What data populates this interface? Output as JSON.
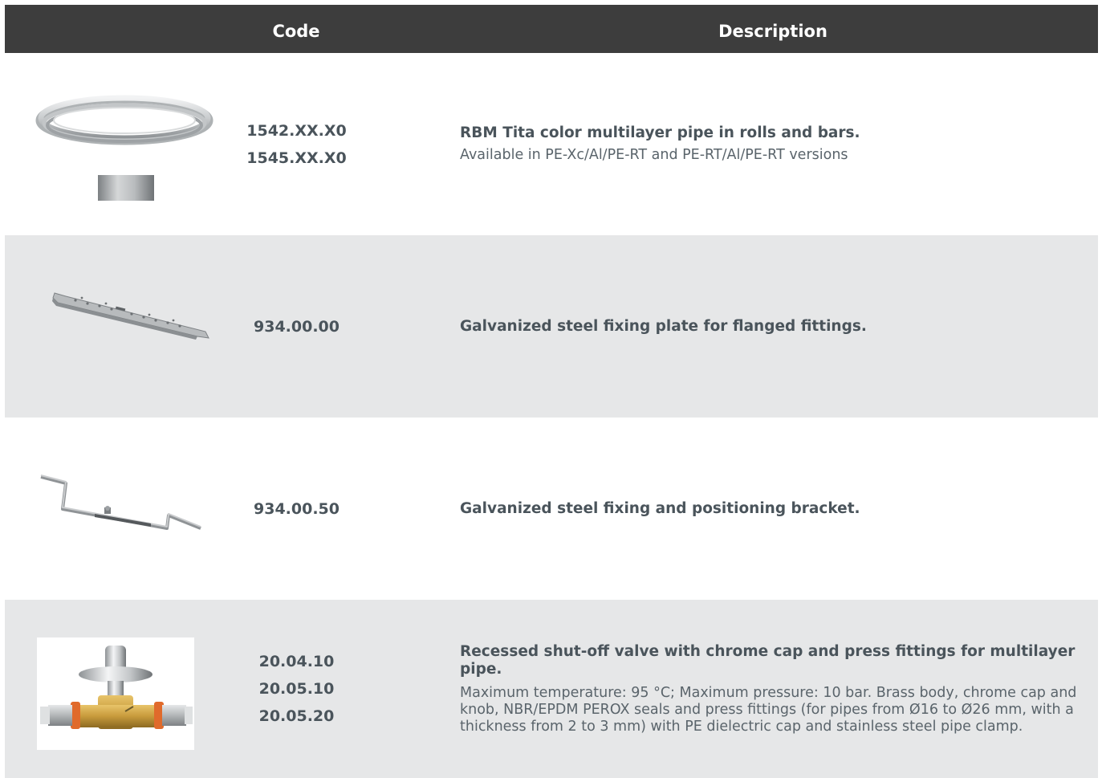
{
  "header": {
    "code_label": "Code",
    "description_label": "Description",
    "background_color": "#3d3d3d"
  },
  "rows": [
    {
      "image": "multilayer-pipe-coil-icon",
      "codes": [
        "1542.XX.X0",
        "1545.XX.X0"
      ],
      "title": "RBM Tita color multilayer pipe in rolls and bars.",
      "body": "Available in PE-Xc/Al/PE-RT and PE-RT/Al/PE-RT versions",
      "shaded": false
    },
    {
      "image": "fixing-plate-icon",
      "codes": [
        "934.00.00"
      ],
      "title": "Galvanized steel fixing plate for flanged fittings.",
      "body": "",
      "shaded": true
    },
    {
      "image": "positioning-bracket-icon",
      "codes": [
        "934.00.50"
      ],
      "title": "Galvanized steel fixing and positioning bracket.",
      "body": "",
      "shaded": false
    },
    {
      "image": "shut-off-valve-icon",
      "codes": [
        "20.04.10",
        "20.05.10",
        "20.05.20"
      ],
      "title": "Recessed shut-off valve with chrome cap and press fittings for multilayer pipe.",
      "body": "Maximum temperature: 95 °C; Maximum pressure: 10 bar. Brass body, chrome cap and knob, NBR/EPDM PEROX seals and press fittings (for pipes from Ø16 to Ø26 mm, with a thickness from 2 to 3 mm) with PE dielectric cap and stainless steel pipe clamp.",
      "shaded": true
    }
  ],
  "colors": {
    "row_shade": "#e6e7e8",
    "text": "#4a545b"
  }
}
